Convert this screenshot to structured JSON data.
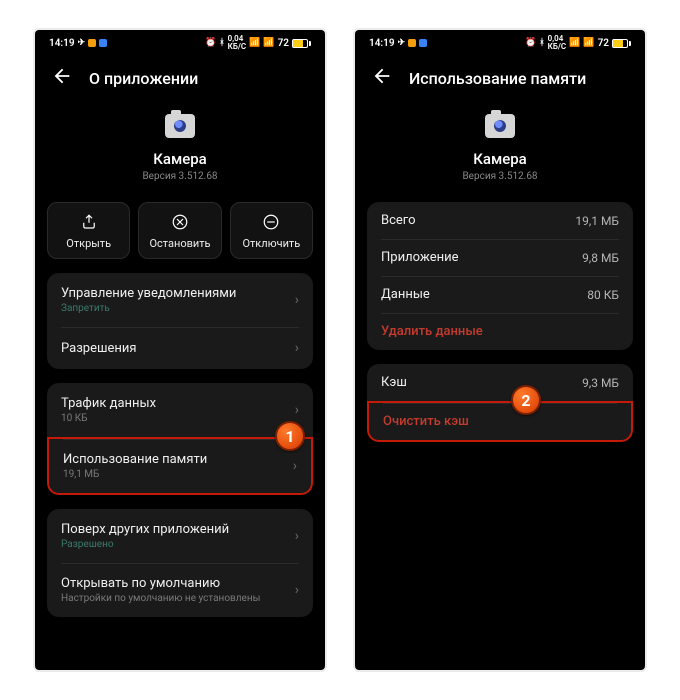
{
  "status": {
    "time": "14:19",
    "speed": "0,04",
    "unit": "КБ/С",
    "batt": "72"
  },
  "left": {
    "title": "О приложении",
    "app": {
      "name": "Камера",
      "version": "Версия 3.512.68"
    },
    "actions": {
      "open": "Открыть",
      "stop": "Остановить",
      "disable": "Отключить"
    },
    "rows": {
      "notif": {
        "label": "Управление уведомлениями",
        "sub": "Запретить"
      },
      "perms": {
        "label": "Разрешения"
      },
      "traffic": {
        "label": "Трафик данных",
        "sub": "10 КБ"
      },
      "memory": {
        "label": "Использование памяти",
        "sub": "19,1 МБ"
      },
      "overlay": {
        "label": "Поверх других приложений",
        "sub": "Разрешено"
      },
      "default": {
        "label": "Открывать по умолчанию",
        "sub": "Настройки по умолчанию не установлены"
      }
    },
    "badge": "1"
  },
  "right": {
    "title": "Использование памяти",
    "app": {
      "name": "Камера",
      "version": "Версия 3.512.68"
    },
    "rows": {
      "total": {
        "label": "Всего",
        "value": "19,1 МБ"
      },
      "appsize": {
        "label": "Приложение",
        "value": "9,8 МБ"
      },
      "data": {
        "label": "Данные",
        "value": "80 КБ"
      },
      "deldata": {
        "label": "Удалить данные"
      },
      "cache": {
        "label": "Кэш",
        "value": "9,3 МБ"
      },
      "clearcache": {
        "label": "Очистить кэш"
      }
    },
    "badge": "2"
  }
}
